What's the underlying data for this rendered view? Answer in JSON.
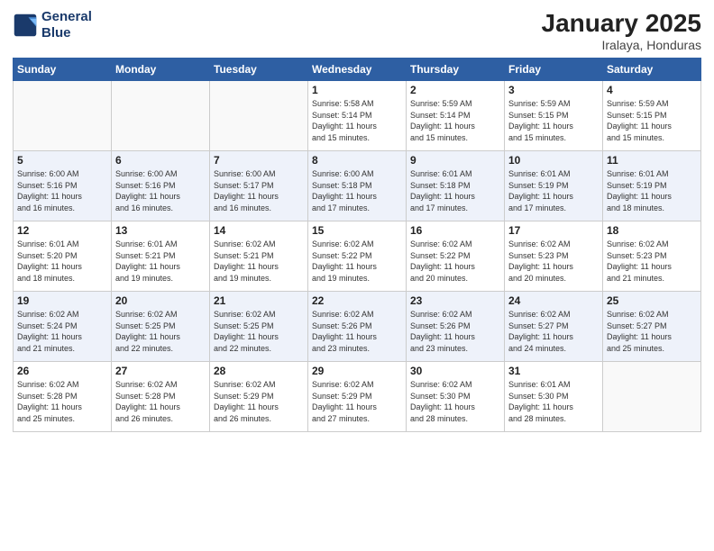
{
  "logo": {
    "line1": "General",
    "line2": "Blue"
  },
  "title": "January 2025",
  "subtitle": "Iralaya, Honduras",
  "days_of_week": [
    "Sunday",
    "Monday",
    "Tuesday",
    "Wednesday",
    "Thursday",
    "Friday",
    "Saturday"
  ],
  "weeks": [
    [
      {
        "day": "",
        "info": ""
      },
      {
        "day": "",
        "info": ""
      },
      {
        "day": "",
        "info": ""
      },
      {
        "day": "1",
        "info": "Sunrise: 5:58 AM\nSunset: 5:14 PM\nDaylight: 11 hours\nand 15 minutes."
      },
      {
        "day": "2",
        "info": "Sunrise: 5:59 AM\nSunset: 5:14 PM\nDaylight: 11 hours\nand 15 minutes."
      },
      {
        "day": "3",
        "info": "Sunrise: 5:59 AM\nSunset: 5:15 PM\nDaylight: 11 hours\nand 15 minutes."
      },
      {
        "day": "4",
        "info": "Sunrise: 5:59 AM\nSunset: 5:15 PM\nDaylight: 11 hours\nand 15 minutes."
      }
    ],
    [
      {
        "day": "5",
        "info": "Sunrise: 6:00 AM\nSunset: 5:16 PM\nDaylight: 11 hours\nand 16 minutes."
      },
      {
        "day": "6",
        "info": "Sunrise: 6:00 AM\nSunset: 5:16 PM\nDaylight: 11 hours\nand 16 minutes."
      },
      {
        "day": "7",
        "info": "Sunrise: 6:00 AM\nSunset: 5:17 PM\nDaylight: 11 hours\nand 16 minutes."
      },
      {
        "day": "8",
        "info": "Sunrise: 6:00 AM\nSunset: 5:18 PM\nDaylight: 11 hours\nand 17 minutes."
      },
      {
        "day": "9",
        "info": "Sunrise: 6:01 AM\nSunset: 5:18 PM\nDaylight: 11 hours\nand 17 minutes."
      },
      {
        "day": "10",
        "info": "Sunrise: 6:01 AM\nSunset: 5:19 PM\nDaylight: 11 hours\nand 17 minutes."
      },
      {
        "day": "11",
        "info": "Sunrise: 6:01 AM\nSunset: 5:19 PM\nDaylight: 11 hours\nand 18 minutes."
      }
    ],
    [
      {
        "day": "12",
        "info": "Sunrise: 6:01 AM\nSunset: 5:20 PM\nDaylight: 11 hours\nand 18 minutes."
      },
      {
        "day": "13",
        "info": "Sunrise: 6:01 AM\nSunset: 5:21 PM\nDaylight: 11 hours\nand 19 minutes."
      },
      {
        "day": "14",
        "info": "Sunrise: 6:02 AM\nSunset: 5:21 PM\nDaylight: 11 hours\nand 19 minutes."
      },
      {
        "day": "15",
        "info": "Sunrise: 6:02 AM\nSunset: 5:22 PM\nDaylight: 11 hours\nand 19 minutes."
      },
      {
        "day": "16",
        "info": "Sunrise: 6:02 AM\nSunset: 5:22 PM\nDaylight: 11 hours\nand 20 minutes."
      },
      {
        "day": "17",
        "info": "Sunrise: 6:02 AM\nSunset: 5:23 PM\nDaylight: 11 hours\nand 20 minutes."
      },
      {
        "day": "18",
        "info": "Sunrise: 6:02 AM\nSunset: 5:23 PM\nDaylight: 11 hours\nand 21 minutes."
      }
    ],
    [
      {
        "day": "19",
        "info": "Sunrise: 6:02 AM\nSunset: 5:24 PM\nDaylight: 11 hours\nand 21 minutes."
      },
      {
        "day": "20",
        "info": "Sunrise: 6:02 AM\nSunset: 5:25 PM\nDaylight: 11 hours\nand 22 minutes."
      },
      {
        "day": "21",
        "info": "Sunrise: 6:02 AM\nSunset: 5:25 PM\nDaylight: 11 hours\nand 22 minutes."
      },
      {
        "day": "22",
        "info": "Sunrise: 6:02 AM\nSunset: 5:26 PM\nDaylight: 11 hours\nand 23 minutes."
      },
      {
        "day": "23",
        "info": "Sunrise: 6:02 AM\nSunset: 5:26 PM\nDaylight: 11 hours\nand 23 minutes."
      },
      {
        "day": "24",
        "info": "Sunrise: 6:02 AM\nSunset: 5:27 PM\nDaylight: 11 hours\nand 24 minutes."
      },
      {
        "day": "25",
        "info": "Sunrise: 6:02 AM\nSunset: 5:27 PM\nDaylight: 11 hours\nand 25 minutes."
      }
    ],
    [
      {
        "day": "26",
        "info": "Sunrise: 6:02 AM\nSunset: 5:28 PM\nDaylight: 11 hours\nand 25 minutes."
      },
      {
        "day": "27",
        "info": "Sunrise: 6:02 AM\nSunset: 5:28 PM\nDaylight: 11 hours\nand 26 minutes."
      },
      {
        "day": "28",
        "info": "Sunrise: 6:02 AM\nSunset: 5:29 PM\nDaylight: 11 hours\nand 26 minutes."
      },
      {
        "day": "29",
        "info": "Sunrise: 6:02 AM\nSunset: 5:29 PM\nDaylight: 11 hours\nand 27 minutes."
      },
      {
        "day": "30",
        "info": "Sunrise: 6:02 AM\nSunset: 5:30 PM\nDaylight: 11 hours\nand 28 minutes."
      },
      {
        "day": "31",
        "info": "Sunrise: 6:01 AM\nSunset: 5:30 PM\nDaylight: 11 hours\nand 28 minutes."
      },
      {
        "day": "",
        "info": ""
      }
    ]
  ]
}
